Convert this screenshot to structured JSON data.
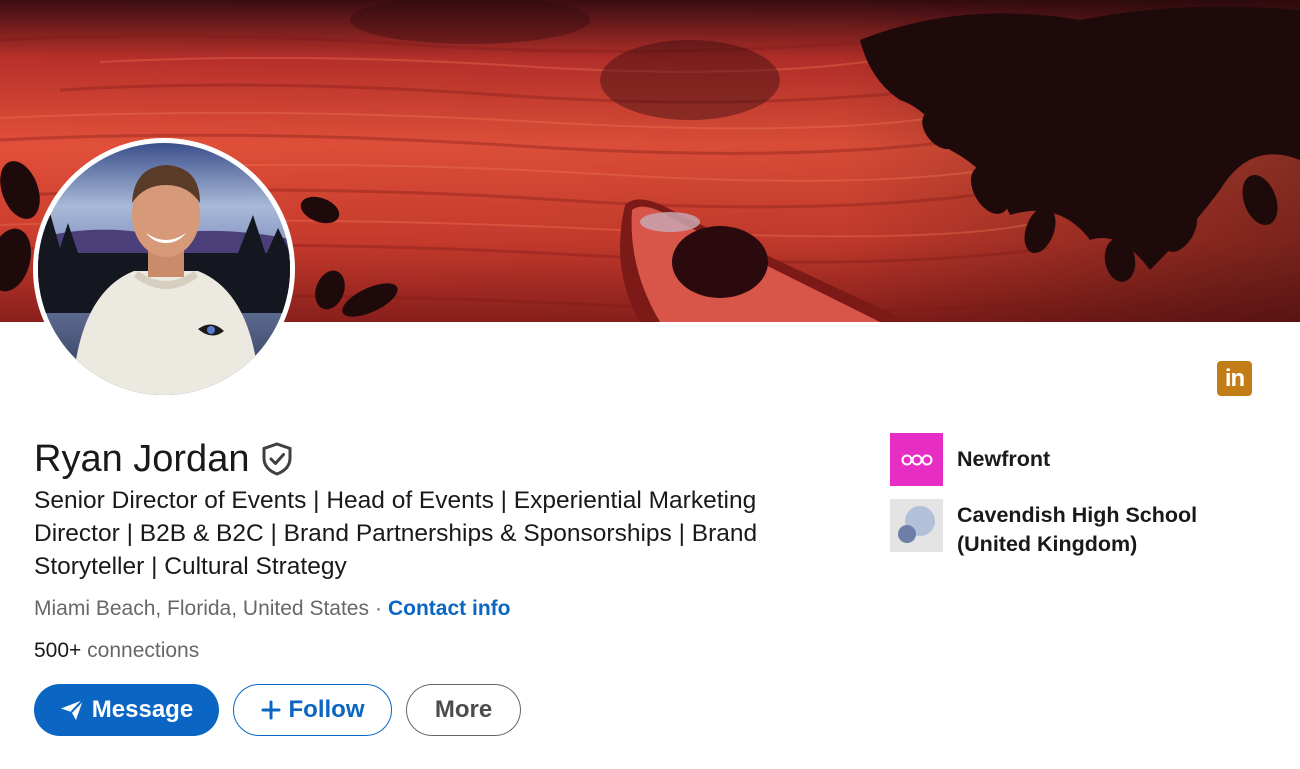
{
  "profile": {
    "name": "Ryan Jordan",
    "headline": "Senior Director of Events | Head of Events | Experiential Marketing Director | B2B & B2C | Brand Partnerships & Sponsorships | Brand Storyteller | Cultural Strategy",
    "location": "Miami Beach, Florida, United States",
    "separator": "·",
    "contact_label": "Contact info",
    "connections_count": "500+",
    "connections_label": "connections"
  },
  "badge": {
    "label": "in"
  },
  "actions": {
    "message_label": "Message",
    "follow_label": "Follow",
    "more_label": "More"
  },
  "orgs": [
    {
      "name": "Newfront",
      "icon": "newfront-logo"
    },
    {
      "name": "Cavendish High School (United Kingdom)",
      "icon": "school-logo"
    }
  ],
  "colors": {
    "accent": "#0a66c2",
    "badge": "#c37d16",
    "newfront": "#e62ec4"
  }
}
